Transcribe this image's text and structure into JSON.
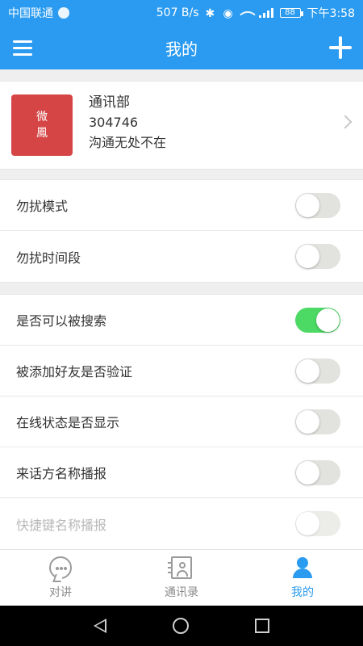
{
  "status_bar": {
    "carrier": "中国联通",
    "speed": "507 B/s",
    "battery": "88",
    "time": "下午3:58"
  },
  "appbar": {
    "title": "我的",
    "menu_icon": "hamburger-menu-icon",
    "add_icon": "plus-icon"
  },
  "profile": {
    "avatar_text": [
      "微",
      "鳳"
    ],
    "name": "通讯部",
    "number": "304746",
    "slogan": "沟通无处不在"
  },
  "settings": {
    "group1": [
      {
        "label": "勿扰模式",
        "on": false,
        "disabled": false
      },
      {
        "label": "勿扰时间段",
        "on": false,
        "disabled": false
      }
    ],
    "group2": [
      {
        "label": "是否可以被搜索",
        "on": true,
        "disabled": false
      },
      {
        "label": "被添加好友是否验证",
        "on": false,
        "disabled": false
      },
      {
        "label": "在线状态是否显示",
        "on": false,
        "disabled": false
      },
      {
        "label": "来话方名称播报",
        "on": false,
        "disabled": false
      },
      {
        "label": "快捷键名称播报",
        "on": false,
        "disabled": true
      }
    ]
  },
  "tabs": [
    {
      "label": "对讲",
      "icon": "chat-bubble-icon",
      "active": false
    },
    {
      "label": "通讯录",
      "icon": "contacts-icon",
      "active": false
    },
    {
      "label": "我的",
      "icon": "profile-icon",
      "active": true
    }
  ],
  "colors": {
    "primary": "#2a9bf0",
    "toggle_on": "#4cd964",
    "avatar_bg": "#d64545"
  }
}
